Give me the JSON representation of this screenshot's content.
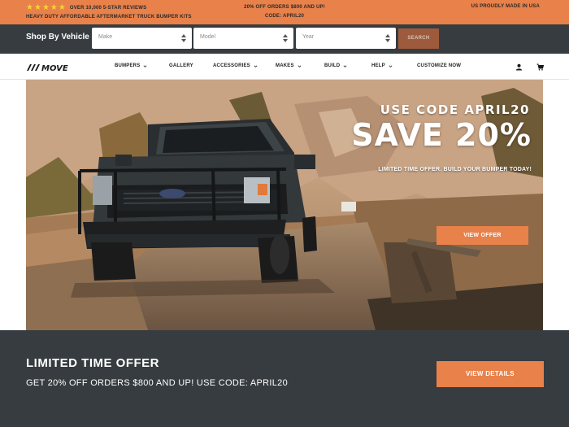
{
  "promo": {
    "rating_stars": 5,
    "reviews": "OVER 10,000 5-STAR REVIEWS",
    "tagline": "HEAVY DUTY AFFORDABLE AFTERMARKET TRUCK BUMPER KITS",
    "offer_line1": "20% OFF ORDERS $800 AND UP!",
    "offer_line2": "CODE: APRIL20",
    "made_in": "US PROUDLY MADE IN USA"
  },
  "vehicle": {
    "title": "Shop By Vehicle",
    "make_placeholder": "Make",
    "model_placeholder": "Model",
    "year_placeholder": "Year",
    "search_label": "SEARCH"
  },
  "nav": {
    "logo_text": "MOVE",
    "items": [
      "BUMPERS",
      "GALLERY",
      "ACCESSORIES",
      "MAKES",
      "BUILD",
      "HELP",
      "CUSTOMIZE NOW"
    ]
  },
  "hero": {
    "code_text": "USE CODE APRIL20",
    "headline": "SAVE 20%",
    "subtext": "LIMITED TIME OFFER. BUILD YOUR BUMPER TODAY!",
    "button_label": "VIEW OFFER"
  },
  "offer": {
    "title": "LIMITED TIME OFFER",
    "subtitle": "GET 20% OFF ORDERS $800 AND UP! USE CODE: APRIL20",
    "button_label": "VIEW DETAILS"
  },
  "colors": {
    "accent": "#e8814a",
    "dark": "#363c3f",
    "star": "#f5d230"
  }
}
